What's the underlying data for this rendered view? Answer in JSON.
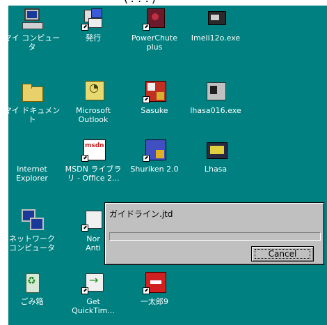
{
  "top_caption": "(???)",
  "desktop_color": "#008080",
  "icons": [
    {
      "label": "マイ コンピュータ",
      "icon": "computer-icon",
      "glyph": "g-computer",
      "shortcut": false
    },
    {
      "label": "発行",
      "icon": "publish-icon",
      "glyph": "g-multi",
      "shortcut": true
    },
    {
      "label": "PowerChute\nplus",
      "icon": "powerchute-icon",
      "glyph": "g-power",
      "shortcut": true
    },
    {
      "label": "Imeli12o.exe",
      "icon": "installer-icon",
      "glyph": "g-inst",
      "shortcut": false
    },
    {
      "label": "マイ ドキュメント",
      "icon": "folder-icon",
      "glyph": "g-folder",
      "shortcut": false
    },
    {
      "label": "Microsoft\nOutlook",
      "icon": "outlook-icon",
      "glyph": "g-outlook",
      "shortcut": false
    },
    {
      "label": "Sasuke",
      "icon": "sasuke-icon",
      "glyph": "g-sasuke",
      "shortcut": true
    },
    {
      "label": "lhasa016.exe",
      "icon": "lhasa-installer-icon",
      "glyph": "g-lhasa",
      "shortcut": false
    },
    {
      "label": "Internet\nExplorer",
      "icon": "internet-explorer-icon",
      "glyph": "g-ie",
      "shortcut": false
    },
    {
      "label": "MSDN ライブラ\nリ - Office 2...",
      "icon": "msdn-icon",
      "glyph": "g-msdn",
      "shortcut": true
    },
    {
      "label": "Shuriken 2.0",
      "icon": "shuriken-icon",
      "glyph": "g-shuriken",
      "shortcut": true
    },
    {
      "label": "Lhasa",
      "icon": "lhasa-icon",
      "glyph": "g-lhasa2",
      "shortcut": false
    },
    {
      "label": "ネットワーク\nコンピュータ",
      "icon": "network-icon",
      "glyph": "g-network",
      "shortcut": false
    },
    {
      "label": "Nor\nAnti",
      "icon": "norton-icon",
      "glyph": "g-norton",
      "shortcut": true
    },
    {
      "label": "ごみ箱",
      "icon": "recycle-bin-icon",
      "glyph": "g-recycle",
      "shortcut": false
    },
    {
      "label": "Get\nQuickTim...",
      "icon": "quicktime-icon",
      "glyph": "g-get",
      "shortcut": true
    },
    {
      "label": "一太郎9",
      "icon": "ichitaro-icon",
      "glyph": "g-ichitaro",
      "shortcut": true
    }
  ],
  "dialog": {
    "title": "ガイドライン.jtd",
    "progress": 0,
    "cancel_label": "Cancel"
  }
}
